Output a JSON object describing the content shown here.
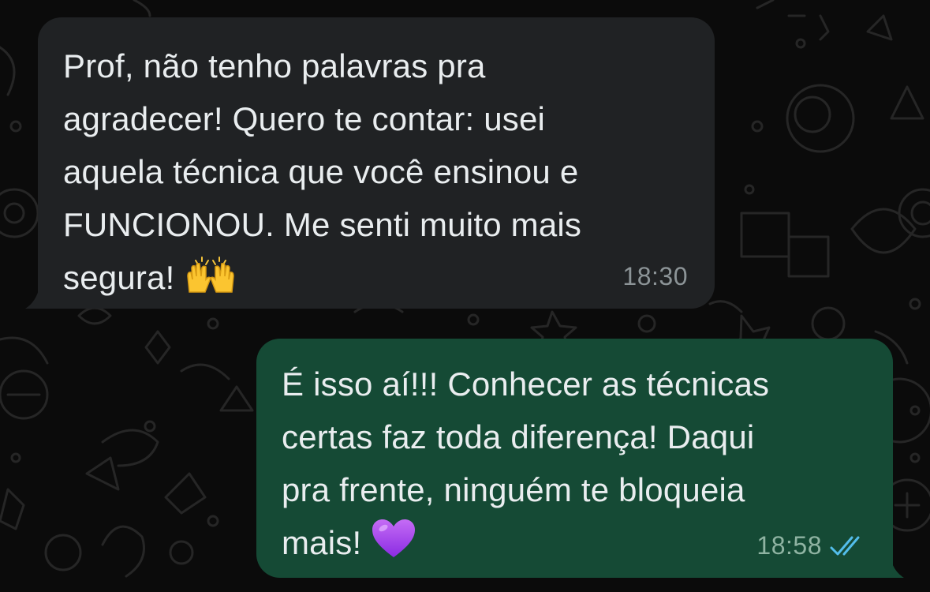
{
  "chat": {
    "messages": [
      {
        "direction": "incoming",
        "lines": [
          "Prof, não tenho palavras pra",
          "agradecer! Quero te contar: usei",
          "aquela técnica que você ensinou e",
          "FUNCIONOU. Me senti muito mais",
          "segura!"
        ],
        "emoji": "raising-hands",
        "time": "18:30"
      },
      {
        "direction": "outgoing",
        "lines": [
          "É isso aí!!! Conhecer as técnicas",
          "certas faz toda diferença! Daqui",
          "pra frente, ninguém te bloqueia",
          "mais!"
        ],
        "emoji": "purple-heart",
        "time": "18:58",
        "status": "read"
      }
    ]
  },
  "colors": {
    "background": "#0b0b0b",
    "incoming_bubble": "#202224",
    "outgoing_bubble": "#154a35",
    "text": "#e9edef",
    "read_ticks": "#53bdeb"
  }
}
